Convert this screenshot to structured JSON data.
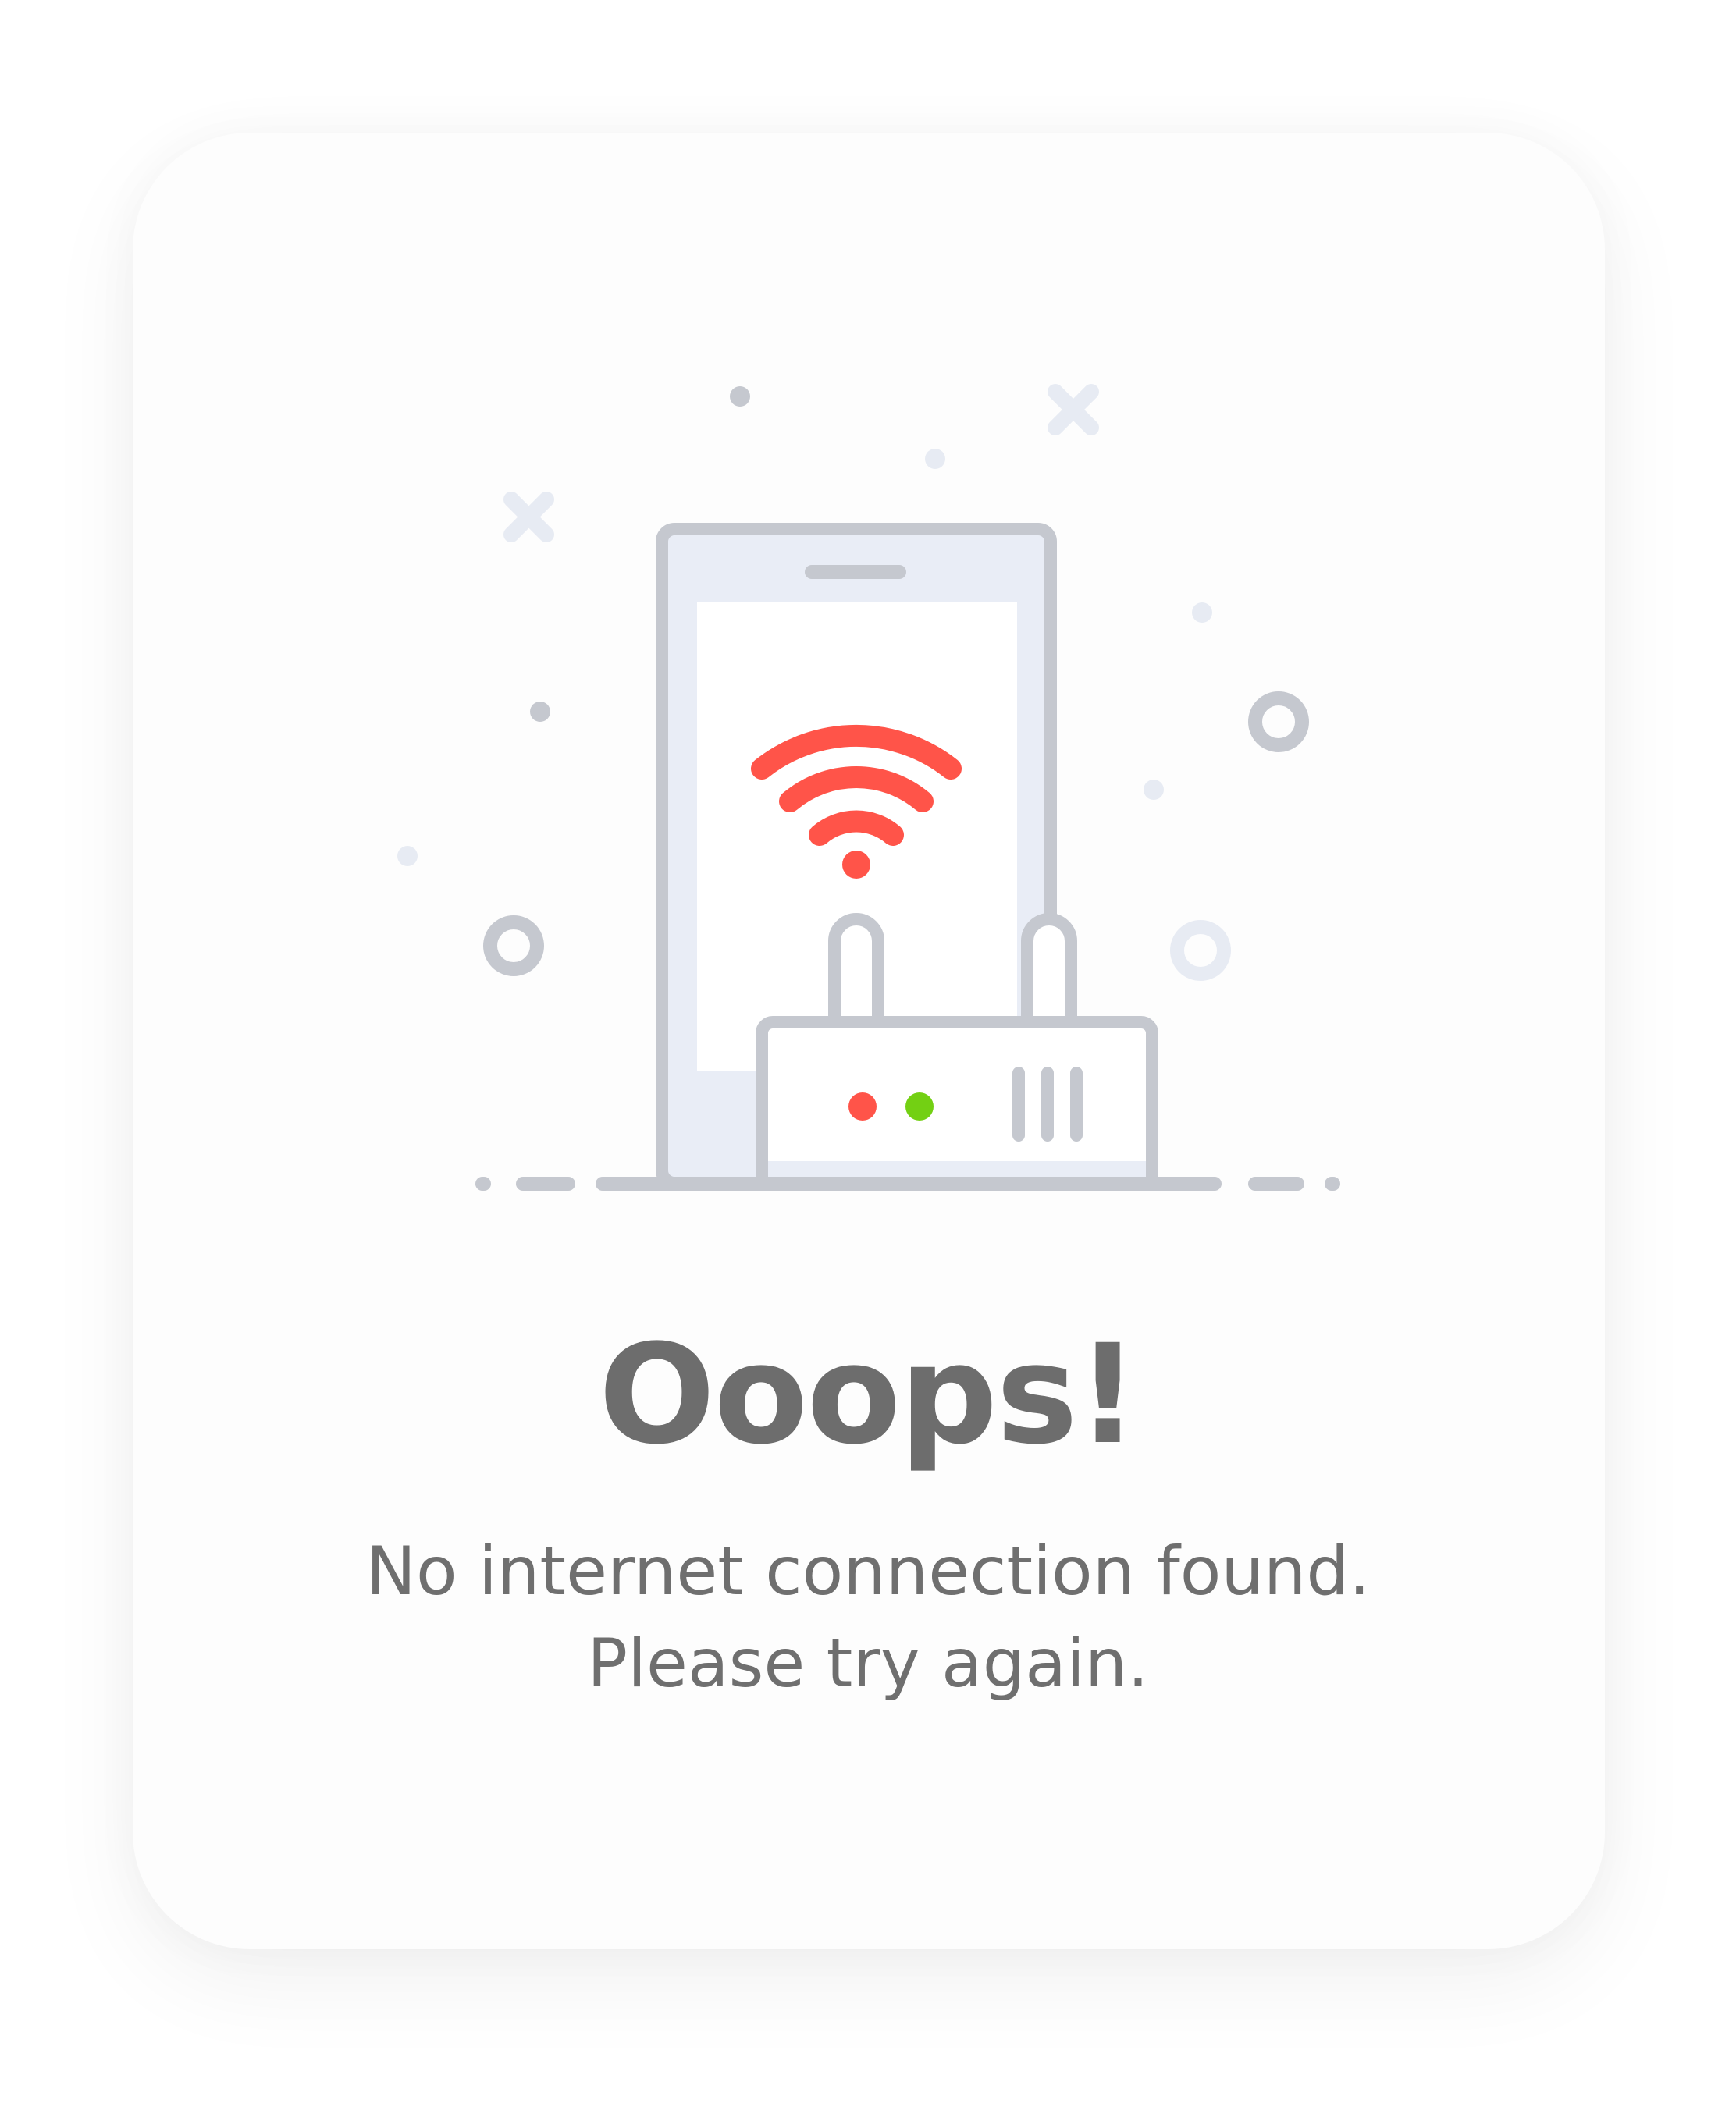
{
  "error": {
    "title": "Ooops!",
    "message_line1": "No internet connection found.",
    "message_line2": "Please try again."
  },
  "illustration": {
    "icons": [
      "phone-icon",
      "wifi-icon",
      "router-icon"
    ],
    "colors": {
      "outline": "#c5c8cf",
      "screen_fill": "#e9edf6",
      "wifi": "#ff5449",
      "led_red": "#ff5449",
      "led_green": "#73d013",
      "decor": "#e7ebf3"
    }
  }
}
